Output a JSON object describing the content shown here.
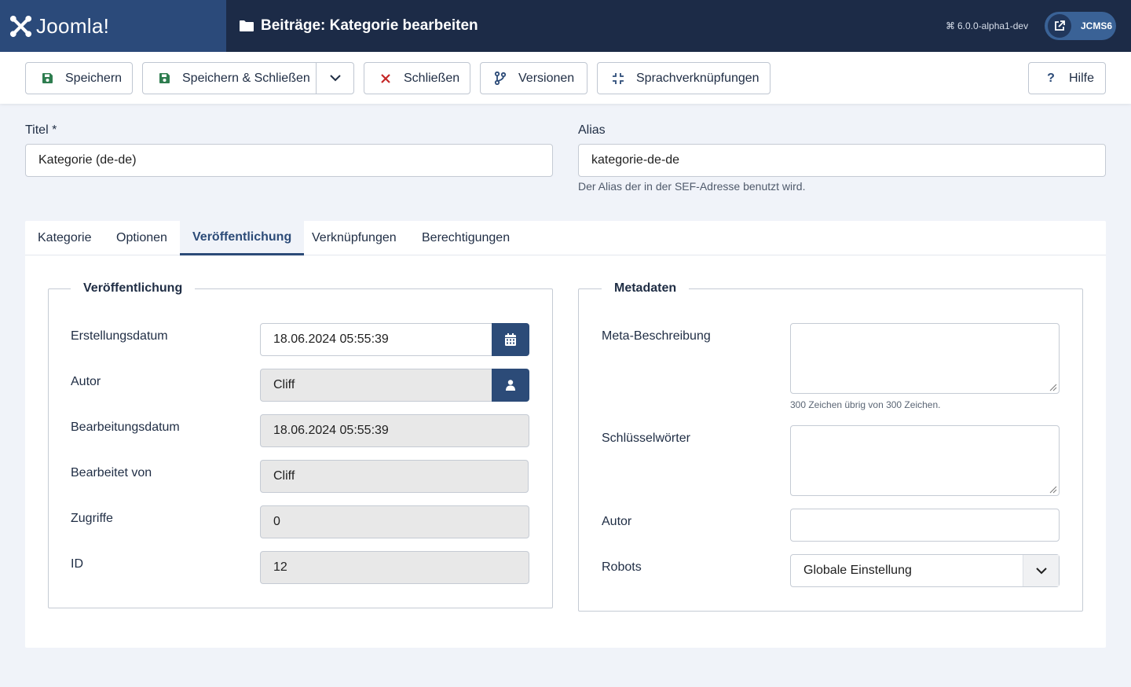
{
  "header": {
    "logo_text": "Joomla!",
    "page_title": "Beiträge: Kategorie bearbeiten",
    "version": "6.0.0-alpha1-dev",
    "site_label": "JCMS6",
    "colors": {
      "header_bg": "#1c2b47",
      "logo_bg": "#2b4a7a",
      "site_btn": "#3a6296"
    }
  },
  "toolbar": {
    "save": "Speichern",
    "save_close": "Speichern & Schließen",
    "close": "Schließen",
    "versions": "Versionen",
    "associations": "Sprachverknüpfungen",
    "help": "Hilfe",
    "icons": [
      "save-icon",
      "save-icon",
      "close-x-icon",
      "branch-icon",
      "compress-icon",
      "question-icon"
    ]
  },
  "form": {
    "title_label": "Titel *",
    "title_value": "Kategorie (de-de)",
    "alias_label": "Alias",
    "alias_value": "kategorie-de-de",
    "alias_hint": "Der Alias der in der SEF-Adresse benutzt wird."
  },
  "tabs": [
    "Kategorie",
    "Optionen",
    "Veröffentlichung",
    "Verknüpfungen",
    "Berechtigungen"
  ],
  "active_tab": "Veröffentlichung",
  "publishing": {
    "legend": "Veröffentlichung",
    "created_label": "Erstellungsdatum",
    "created_value": "18.06.2024 05:55:39",
    "author_label": "Autor",
    "author_value": "Cliff",
    "modified_label": "Bearbeitungsdatum",
    "modified_value": "18.06.2024 05:55:39",
    "modified_by_label": "Bearbeitet von",
    "modified_by_value": "Cliff",
    "hits_label": "Zugriffe",
    "hits_value": "0",
    "id_label": "ID",
    "id_value": "12"
  },
  "metadata": {
    "legend": "Metadaten",
    "description_label": "Meta-Beschreibung",
    "description_value": "",
    "char_hint": "300 Zeichen übrig von 300 Zeichen.",
    "keywords_label": "Schlüsselwörter",
    "keywords_value": "",
    "author_label": "Autor",
    "author_value": "",
    "robots_label": "Robots",
    "robots_value": "Globale Einstellung"
  }
}
